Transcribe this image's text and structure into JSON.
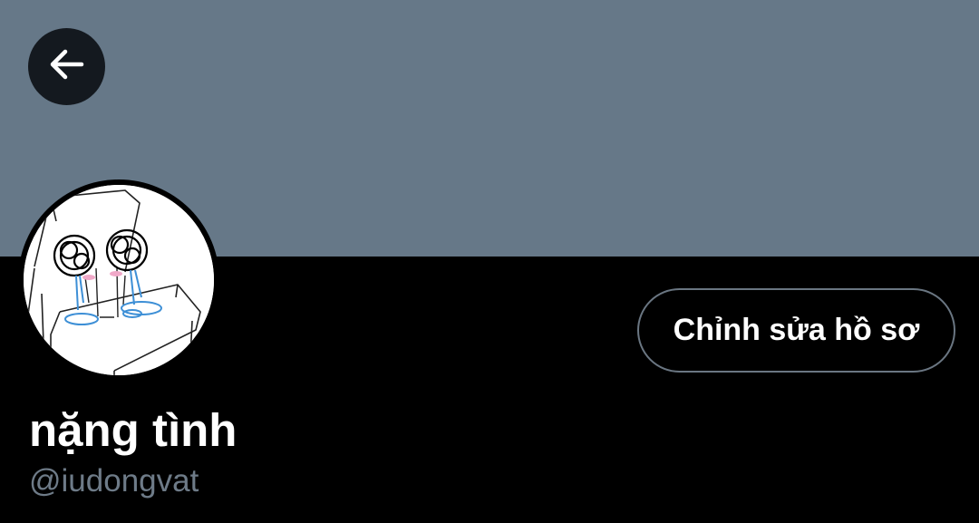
{
  "header": {
    "back_icon": "arrow-left-icon",
    "banner_color": "#667888"
  },
  "profile": {
    "avatar_description_icon": "avatar-image",
    "edit_button_label": "Chỉnh sửa hồ sơ",
    "display_name": "nặng tình",
    "handle": "@iudongvat"
  },
  "colors": {
    "background": "#000000",
    "text_primary": "#ffffff",
    "text_secondary": "#6e7b88",
    "button_border": "#6a7682"
  }
}
